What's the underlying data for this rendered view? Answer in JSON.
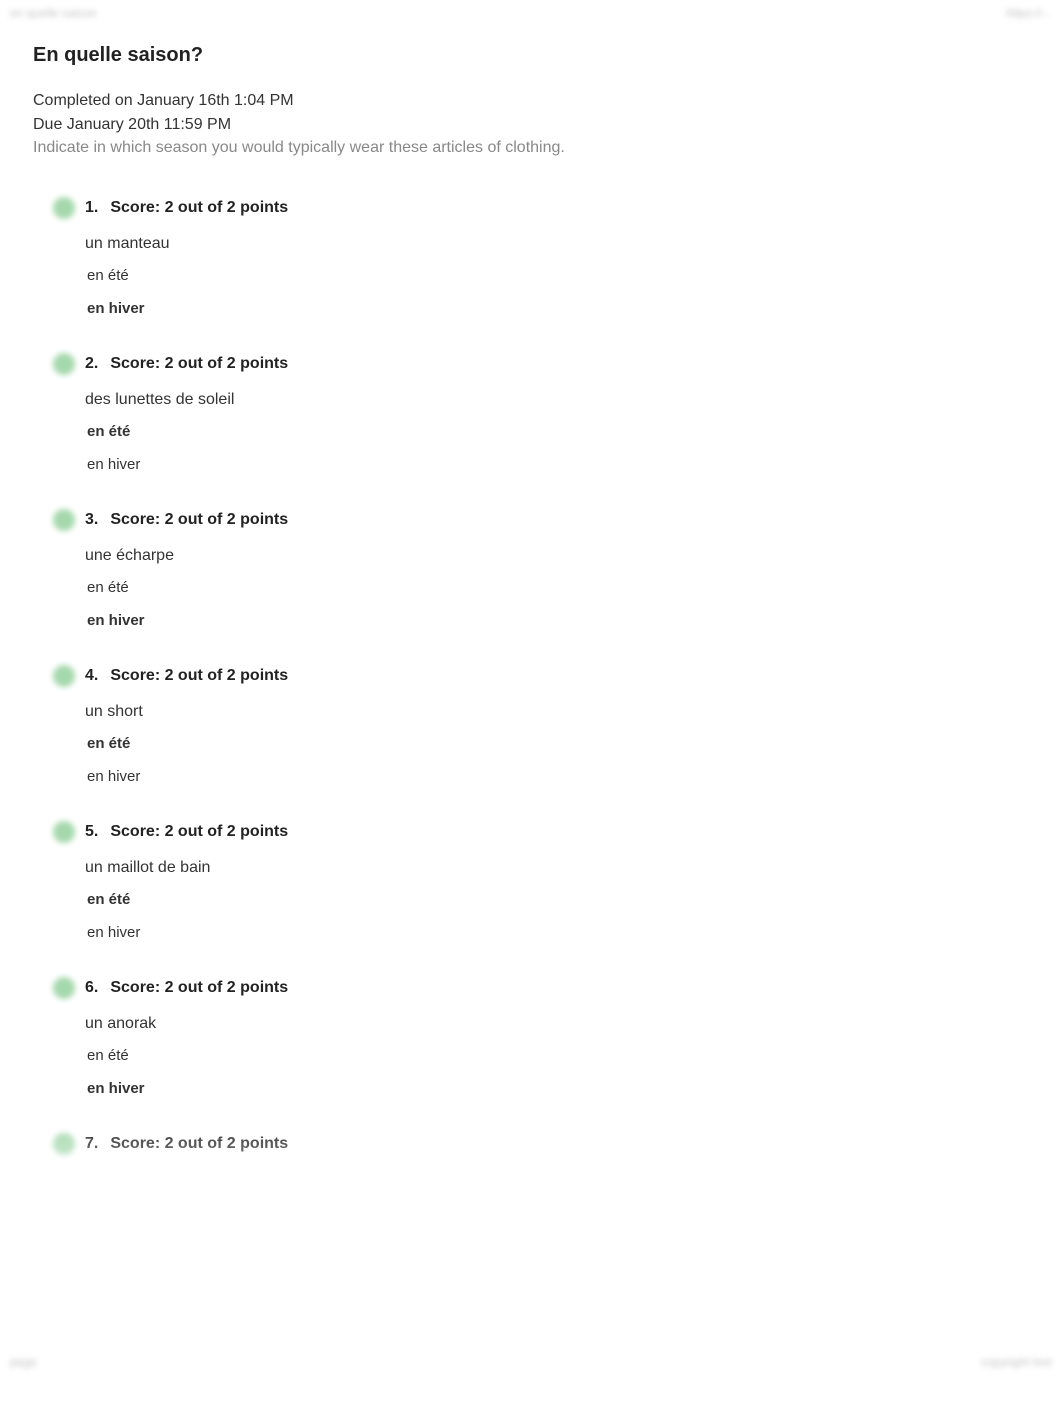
{
  "topbar": {
    "left": "en quelle saison",
    "right": "https://..."
  },
  "header": {
    "title": "En quelle saison?",
    "completed": "Completed on January 16th 1:04 PM",
    "due": "Due January 20th 11:59 PM",
    "instructions": "Indicate in which season you would typically wear these articles of clothing."
  },
  "questions": [
    {
      "num": "1.",
      "score": "Score: 2 out of 2 points",
      "prompt": "un manteau",
      "options": [
        {
          "text": "en été",
          "correct": false
        },
        {
          "text": "en hiver",
          "correct": true
        }
      ]
    },
    {
      "num": "2.",
      "score": "Score: 2 out of 2 points",
      "prompt": "des lunettes de soleil",
      "options": [
        {
          "text": "en été",
          "correct": true
        },
        {
          "text": "en hiver",
          "correct": false
        }
      ]
    },
    {
      "num": "3.",
      "score": "Score: 2 out of 2 points",
      "prompt": "une écharpe",
      "options": [
        {
          "text": "en été",
          "correct": false
        },
        {
          "text": "en hiver",
          "correct": true
        }
      ]
    },
    {
      "num": "4.",
      "score": "Score: 2 out of 2 points",
      "prompt": "un short",
      "options": [
        {
          "text": "en été",
          "correct": true
        },
        {
          "text": "en hiver",
          "correct": false
        }
      ]
    },
    {
      "num": "5.",
      "score": "Score: 2 out of 2 points",
      "prompt": "un maillot de bain",
      "options": [
        {
          "text": "en été",
          "correct": true
        },
        {
          "text": "en hiver",
          "correct": false
        }
      ]
    },
    {
      "num": "6.",
      "score": "Score: 2 out of 2 points",
      "prompt": "un anorak",
      "options": [
        {
          "text": "en été",
          "correct": false
        },
        {
          "text": "en hiver",
          "correct": true
        }
      ]
    },
    {
      "num": "7.",
      "score": "Score: 2 out of 2 points",
      "prompt": "",
      "options": []
    }
  ],
  "bottombar": {
    "left": "page",
    "right": "copyright text"
  }
}
